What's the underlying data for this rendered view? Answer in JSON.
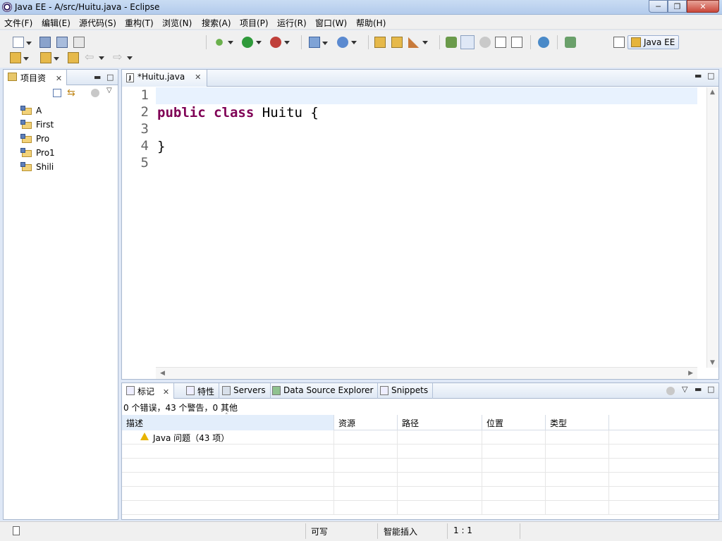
{
  "window": {
    "title": "Java EE  -  A/src/Huitu.java  -  Eclipse"
  },
  "menubar": {
    "items": [
      "文件(F)",
      "编辑(E)",
      "源代码(S)",
      "重构(T)",
      "浏览(N)",
      "搜索(A)",
      "项目(P)",
      "运行(R)",
      "窗口(W)",
      "帮助(H)"
    ]
  },
  "toolbar": {
    "perspective_label": "Java EE"
  },
  "explorer": {
    "tab_label": "项目资",
    "projects": [
      "A",
      "First",
      "Pro",
      "Pro1",
      "Shili"
    ]
  },
  "editor": {
    "tab_label": "*Huitu.java",
    "line_numbers": [
      "1",
      "2",
      "3",
      "4",
      "5"
    ],
    "lines": [
      "",
      "public class Huitu {",
      "",
      "}",
      ""
    ]
  },
  "bottom_panel": {
    "tabs": [
      "标记",
      "特性",
      "Servers",
      "Data Source Explorer",
      "Snippets"
    ],
    "summary": "0 个错误，43 个警告，0 其他",
    "columns": [
      "描述",
      "资源",
      "路径",
      "位置",
      "类型"
    ],
    "rows": [
      {
        "description": "Java 问题（43 项）",
        "resource": "",
        "path": "",
        "location": "",
        "type": ""
      }
    ]
  },
  "statusbar": {
    "writable": "可写",
    "insert_mode": "智能插入",
    "position": "1 : 1"
  },
  "colors": {
    "keyword": "#7f0055",
    "current_line": "#e8f2fe",
    "warning": "#e8b400"
  }
}
